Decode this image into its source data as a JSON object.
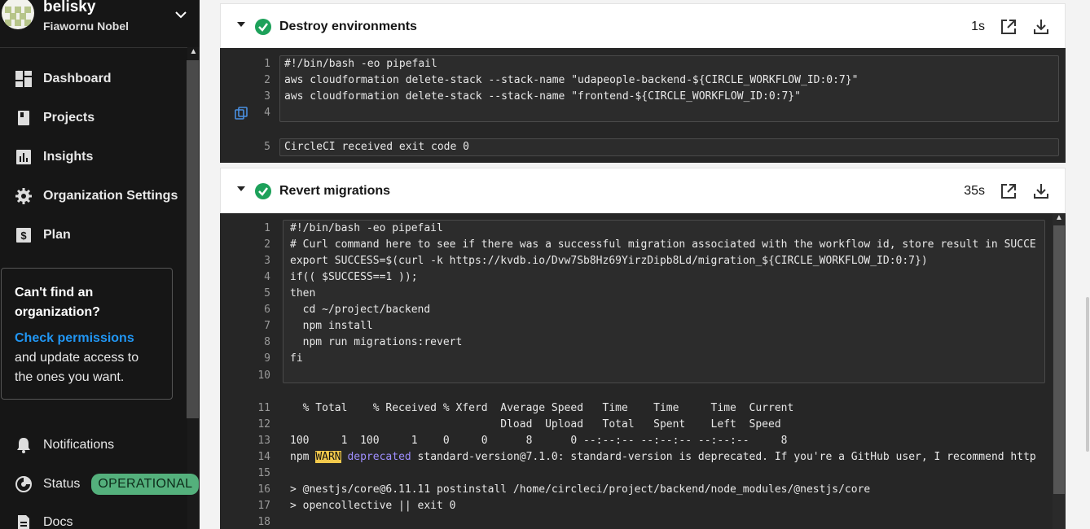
{
  "sidebar": {
    "org_name": "belisky",
    "org_user": "Fiawornu Nobel",
    "nav": [
      {
        "label": "Dashboard",
        "icon": "dashboard-icon"
      },
      {
        "label": "Projects",
        "icon": "projects-icon"
      },
      {
        "label": "Insights",
        "icon": "insights-icon"
      },
      {
        "label": "Organization Settings",
        "icon": "gear-icon"
      },
      {
        "label": "Plan",
        "icon": "dollar-icon"
      }
    ],
    "callout": {
      "title": "Can't find an organization?",
      "link": "Check permissions",
      "rest": " and update access to the ones you want."
    },
    "bottom_nav": [
      {
        "label": "Notifications",
        "icon": "bell-icon"
      },
      {
        "label": "Status",
        "icon": "status-icon",
        "badge": "OPERATIONAL"
      },
      {
        "label": "Docs",
        "icon": "docs-icon"
      }
    ]
  },
  "steps": [
    {
      "title": "Destroy environments",
      "duration": "1s",
      "lines": [
        {
          "n": "1",
          "t": "#!/bin/bash -eo pipefail"
        },
        {
          "n": "2",
          "t": "aws cloudformation delete-stack --stack-name \"udapeople-backend-${CIRCLE_WORKFLOW_ID:0:7}\""
        },
        {
          "n": "3",
          "t": "aws cloudformation delete-stack --stack-name \"frontend-${CIRCLE_WORKFLOW_ID:0:7}\""
        },
        {
          "n": "4",
          "t": ""
        },
        {
          "n": "5",
          "t": "CircleCI received exit code 0"
        }
      ]
    },
    {
      "title": "Revert migrations",
      "duration": "35s",
      "lines": [
        {
          "n": "1",
          "t": "#!/bin/bash -eo pipefail"
        },
        {
          "n": "2",
          "t": "# Curl command here to see if there was a successful migration associated with the workflow id, store result in SUCCE"
        },
        {
          "n": "3",
          "t": "export SUCCESS=$(curl -k https://kvdb.io/Dvw7Sb8Hz69YirzDipb8Ld/migration_${CIRCLE_WORKFLOW_ID:0:7})"
        },
        {
          "n": "4",
          "t": "if(( $SUCCESS==1 ));"
        },
        {
          "n": "5",
          "t": "then"
        },
        {
          "n": "6",
          "t": "  cd ~/project/backend"
        },
        {
          "n": "7",
          "t": "  npm install"
        },
        {
          "n": "8",
          "t": "  npm run migrations:revert"
        },
        {
          "n": "9",
          "t": "fi"
        },
        {
          "n": "10",
          "t": ""
        },
        {
          "n": "11",
          "t": "  % Total    % Received % Xferd  Average Speed   Time    Time     Time  Current"
        },
        {
          "n": "12",
          "t": "                                 Dload  Upload   Total   Spent    Left  Speed"
        },
        {
          "n": "13",
          "t": "100     1  100     1    0     0      8      0 --:--:-- --:--:-- --:--:--     8"
        },
        {
          "n": "14",
          "t_pre": "npm ",
          "t_warn": "WARN",
          "t_dep": " deprecated",
          "t_post": " standard-version@7.1.0: standard-version is deprecated. If you're a GitHub user, I recommend http"
        },
        {
          "n": "15",
          "t": ""
        },
        {
          "n": "16",
          "t": "> @nestjs/core@6.11.11 postinstall /home/circleci/project/backend/node_modules/@nestjs/core"
        },
        {
          "n": "17",
          "t": "> opencollective || exit 0"
        },
        {
          "n": "18",
          "t": ""
        }
      ]
    }
  ]
}
